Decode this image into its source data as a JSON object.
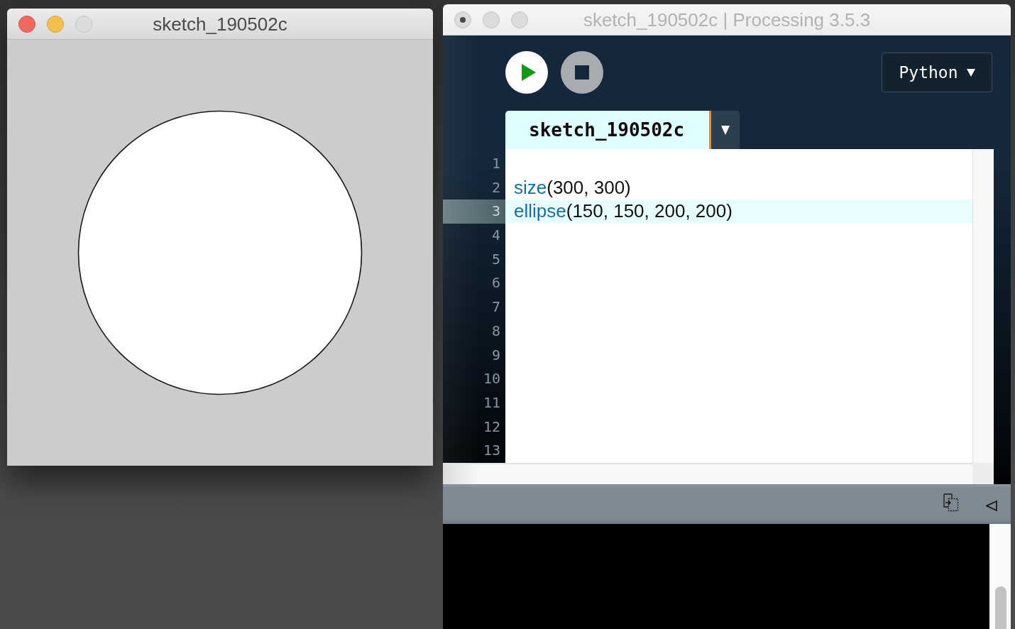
{
  "sketch_window": {
    "title": "sketch_190502c",
    "active": true,
    "edited": false,
    "controls": [
      {
        "kind": "close",
        "enabled": true
      },
      {
        "kind": "minimize",
        "enabled": true
      },
      {
        "kind": "zoom",
        "enabled": false
      }
    ]
  },
  "processing_window": {
    "title": "sketch_190502c | Processing 3.5.3",
    "active": false,
    "edited": true,
    "controls": [
      {
        "kind": "close"
      },
      {
        "kind": "minimize"
      },
      {
        "kind": "zoom"
      }
    ],
    "mode_button": {
      "label": "Python"
    },
    "tabs": [
      {
        "label": "sketch_190502c",
        "selected": true
      }
    ],
    "editor": {
      "lines": [
        {
          "number": "1",
          "current": false
        },
        {
          "number": "2",
          "current": false,
          "tokens": [
            {
              "text": "size",
              "kind": "function"
            },
            {
              "text": "(300, 300)",
              "kind": "plain"
            }
          ]
        },
        {
          "number": "3",
          "current": true,
          "tokens": [
            {
              "text": "ellipse",
              "kind": "function"
            },
            {
              "text": "(150, 150, 200, 200)",
              "kind": "plain"
            }
          ]
        },
        {
          "number": "4",
          "current": false
        },
        {
          "number": "5",
          "current": false
        },
        {
          "number": "6",
          "current": false
        },
        {
          "number": "7",
          "current": false
        },
        {
          "number": "8",
          "current": false
        },
        {
          "number": "9",
          "current": false
        },
        {
          "number": "10",
          "current": false
        },
        {
          "number": "11",
          "current": false
        },
        {
          "number": "12",
          "current": false
        },
        {
          "number": "13",
          "current": false
        }
      ]
    }
  }
}
